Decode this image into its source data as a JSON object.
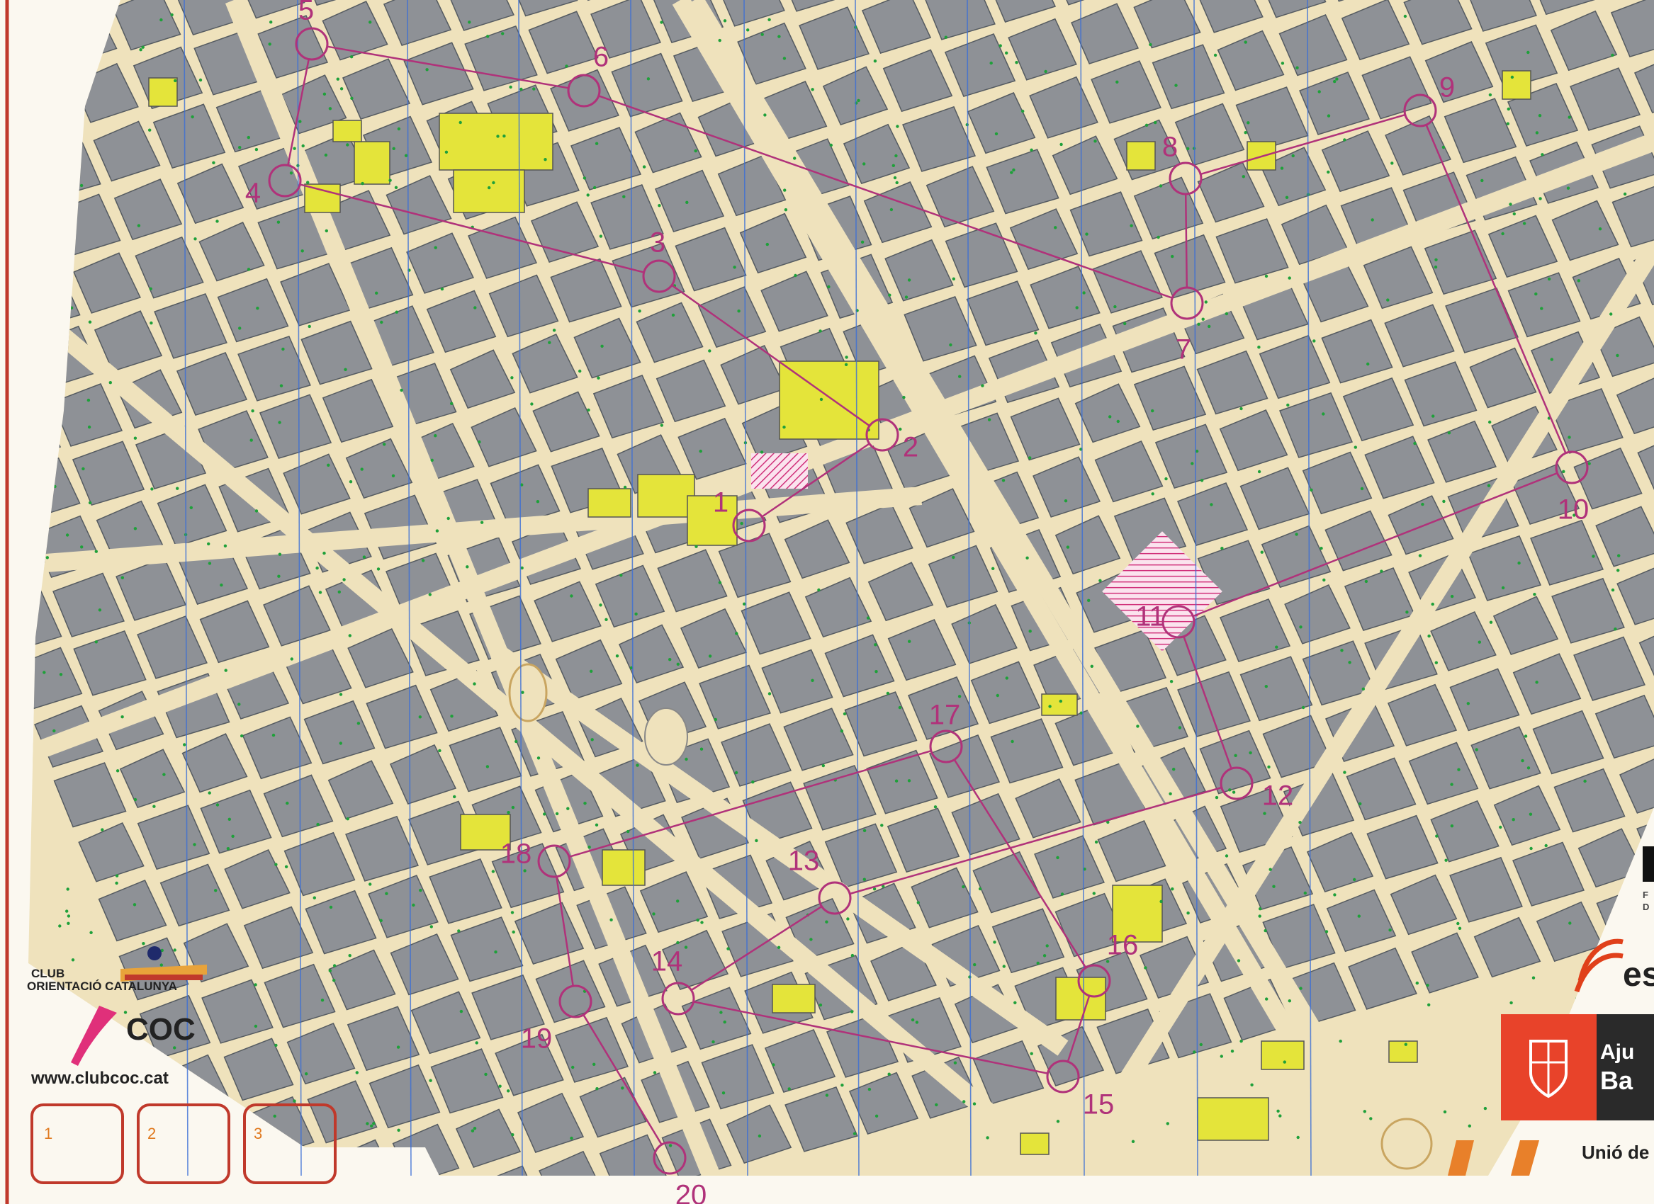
{
  "map": {
    "club_line1": "CLUB",
    "club_line2": "ORIENTACIÓ CATALUNYA",
    "club_abbr": "COC",
    "website": "www.clubcoc.cat",
    "boxes": [
      "1",
      "2",
      "3"
    ],
    "sponsor_es": "es",
    "sponsor_aju": "Aju",
    "sponsor_ba": "Ba",
    "sponsor_unio": "Unió de",
    "sponsor_fd": [
      "F",
      "D"
    ]
  },
  "course": {
    "line_color": "#b0327a",
    "controls": [
      {
        "n": "1",
        "label": "1"
      },
      {
        "n": "2",
        "label": "2"
      },
      {
        "n": "3",
        "label": "3"
      },
      {
        "n": "4",
        "label": "4"
      },
      {
        "n": "5",
        "label": "5"
      },
      {
        "n": "6",
        "label": "6"
      },
      {
        "n": "7",
        "label": "7"
      },
      {
        "n": "8",
        "label": "8"
      },
      {
        "n": "9",
        "label": "9"
      },
      {
        "n": "10",
        "label": "10"
      },
      {
        "n": "11",
        "label": "11"
      },
      {
        "n": "12",
        "label": "12"
      },
      {
        "n": "13",
        "label": "13"
      },
      {
        "n": "14",
        "label": "14"
      },
      {
        "n": "15",
        "label": "15"
      },
      {
        "n": "16",
        "label": "16"
      },
      {
        "n": "17",
        "label": "17"
      },
      {
        "n": "18",
        "label": "18"
      },
      {
        "n": "19",
        "label": "19"
      },
      {
        "n": "20",
        "label": "20"
      }
    ]
  },
  "colors": {
    "building": "#8e9196",
    "street": "#efe2bc",
    "yellow_area": "#e4e43a",
    "magnetic_north": "#3b6fd6",
    "border": "#c0392b"
  }
}
